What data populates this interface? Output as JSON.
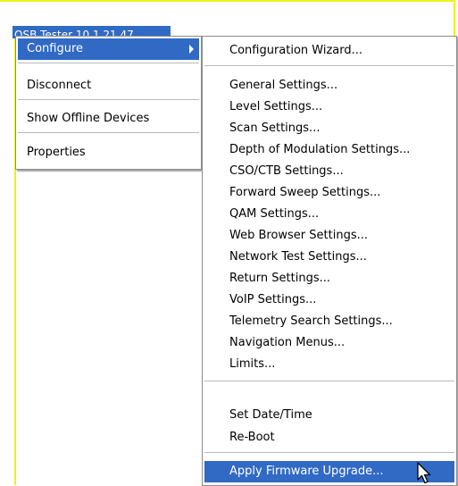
{
  "tree": {
    "selected_label": "OSB Tester 10.1.21.47"
  },
  "main_menu": {
    "items": [
      {
        "label": "Configure"
      },
      {
        "label": "Disconnect"
      },
      {
        "label": "Show Offline Devices"
      },
      {
        "label": "Properties"
      }
    ]
  },
  "submenu": {
    "items": [
      {
        "label": "Configuration Wizard..."
      },
      {
        "label": "General Settings..."
      },
      {
        "label": "Level Settings..."
      },
      {
        "label": "Scan Settings..."
      },
      {
        "label": "Depth of Modulation Settings..."
      },
      {
        "label": "CSO/CTB Settings..."
      },
      {
        "label": "Forward Sweep Settings..."
      },
      {
        "label": "QAM Settings..."
      },
      {
        "label": "Web Browser Settings..."
      },
      {
        "label": "Network Test Settings..."
      },
      {
        "label": "Return Settings..."
      },
      {
        "label": "VoIP Settings..."
      },
      {
        "label": "Telemetry Search Settings..."
      },
      {
        "label": "Navigation Menus..."
      },
      {
        "label": "Limits..."
      },
      {
        "label": "Set Date/Time"
      },
      {
        "label": "Re-Boot"
      },
      {
        "label": "Apply Firmware Upgrade..."
      }
    ]
  },
  "colors": {
    "highlight": "#316ac5",
    "frame_border": "#f0f020"
  },
  "icons": {
    "pointer": "mouse-cursor-icon",
    "submenu_arrow": "chevron-right-icon"
  }
}
